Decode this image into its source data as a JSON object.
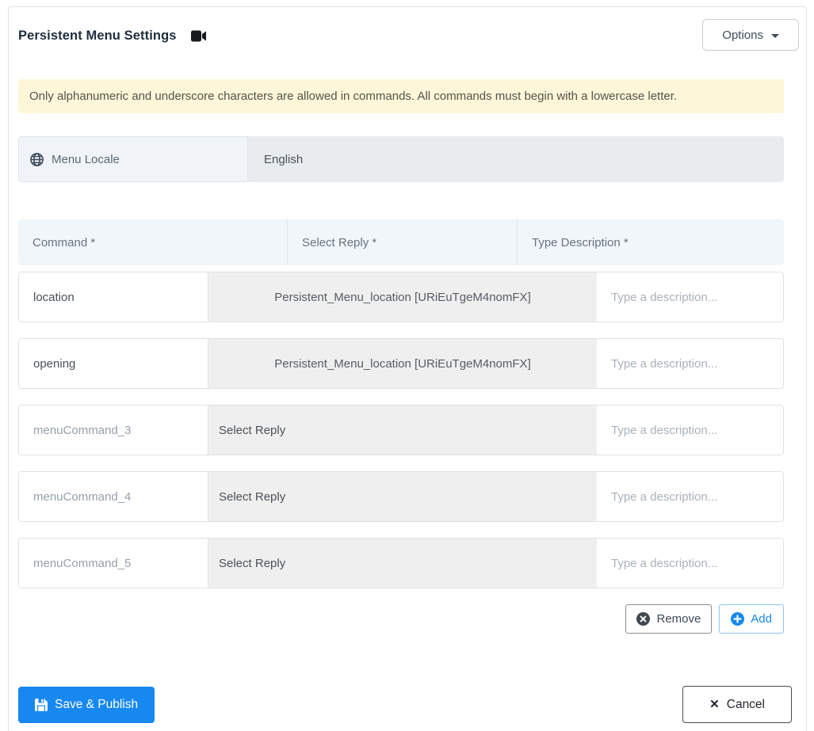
{
  "header": {
    "title": "Persistent Menu Settings",
    "options_label": "Options"
  },
  "banner": {
    "text": "Only alphanumeric and underscore characters are allowed in commands. All commands must begin with a lowercase letter."
  },
  "locale": {
    "label": "Menu Locale",
    "value": "English"
  },
  "table": {
    "columns": [
      "Command *",
      "Select Reply *",
      "Type Description *"
    ],
    "rows": [
      {
        "command": "location",
        "command_is_placeholder": false,
        "reply": "Persistent_Menu_location [URiEuTgeM4nomFX]",
        "reply_selected": true,
        "description_value": "",
        "description_placeholder": "Type a description..."
      },
      {
        "command": "opening",
        "command_is_placeholder": false,
        "reply": "Persistent_Menu_location [URiEuTgeM4nomFX]",
        "reply_selected": true,
        "description_value": "",
        "description_placeholder": "Type a description..."
      },
      {
        "command": "menuCommand_3",
        "command_is_placeholder": true,
        "reply": "Select Reply",
        "reply_selected": false,
        "description_value": "",
        "description_placeholder": "Type a description..."
      },
      {
        "command": "menuCommand_4",
        "command_is_placeholder": true,
        "reply": "Select Reply",
        "reply_selected": false,
        "description_value": "",
        "description_placeholder": "Type a description..."
      },
      {
        "command": "menuCommand_5",
        "command_is_placeholder": true,
        "reply": "Select Reply",
        "reply_selected": false,
        "description_value": "",
        "description_placeholder": "Type a description..."
      }
    ]
  },
  "row_actions": {
    "remove_label": "Remove",
    "add_label": "Add"
  },
  "footer": {
    "save_label": "Save & Publish",
    "cancel_label": "Cancel",
    "cancel_icon_glyph": "✕"
  },
  "icons": {
    "title_icon": "video-camera-icon",
    "locale_icon": "globe-icon",
    "remove_icon": "x-circle-filled-icon",
    "add_icon": "plus-circle-filled-icon",
    "save_icon": "floppy-disk-icon",
    "cancel_icon": "x-icon",
    "options_icon": "caret-down-icon"
  },
  "colors": {
    "primary_blue": "#1788f0",
    "warning_banner_bg": "#fdf6d9",
    "table_header_bg": "#f1f6fa",
    "select_cell_bg": "#efefef",
    "locale_label_bg": "#f0f4f8",
    "locale_value_bg": "#e9ecef",
    "remove_icon_fill": "#40474e",
    "cancel_border": "#454d55"
  }
}
